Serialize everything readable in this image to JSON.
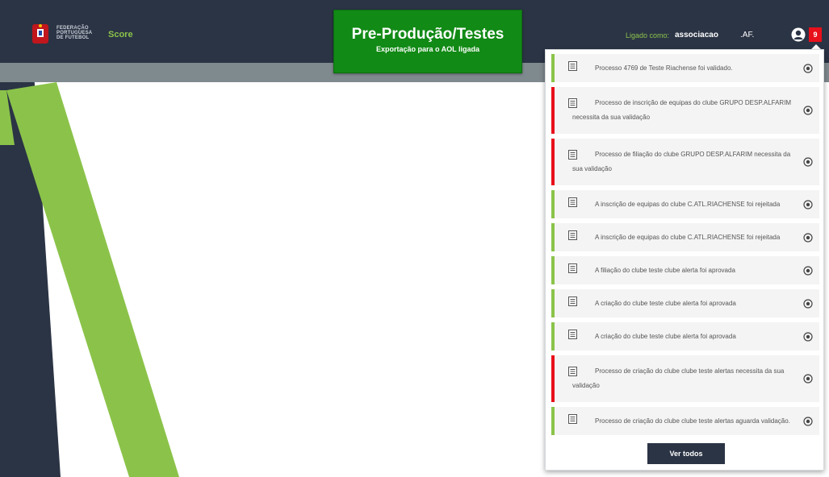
{
  "header": {
    "logo_lines": [
      "FEDERAÇÃO",
      "PORTUGUESA",
      "DE FUTEBOL"
    ],
    "app_name": "Score",
    "logged_label": "Ligado como:",
    "username": "associacao",
    "org": ".AF.",
    "notification_count": "9"
  },
  "environment": {
    "title": "Pre-Produção/Testes",
    "subtitle": "Exportação para o AOL ligada"
  },
  "notifications": {
    "items": [
      {
        "text": "Processo 4769 de Teste Riachense foi validado.",
        "status": "green"
      },
      {
        "text": "Processo de inscrição de equipas do clube GRUPO DESP.ALFARIM necessita da sua validação",
        "status": "red"
      },
      {
        "text": "Processo de filiação do clube GRUPO DESP.ALFARIM necessita da sua validação",
        "status": "red"
      },
      {
        "text": "A inscrição de equipas do clube C.ATL.RIACHENSE foi rejeitada",
        "status": "green"
      },
      {
        "text": "A inscrição de equipas do clube C.ATL.RIACHENSE foi rejeitada",
        "status": "green"
      },
      {
        "text": "A filiação do clube teste clube alerta foi aprovada",
        "status": "green"
      },
      {
        "text": "A criação do clube teste clube alerta foi aprovada",
        "status": "green"
      },
      {
        "text": "A criação do clube teste clube alerta foi aprovada",
        "status": "green"
      },
      {
        "text": "Processo de criação do clube clube teste alertas necessita da sua validação",
        "status": "red"
      },
      {
        "text": "Processo de criação do clube clube teste alertas aguarda validação.",
        "status": "green"
      }
    ],
    "see_all_label": "Ver todos"
  },
  "colors": {
    "header": "#2b3445",
    "accent_green": "#8bc34a",
    "alert_red": "#e8101a",
    "banner_green": "#128a16"
  }
}
